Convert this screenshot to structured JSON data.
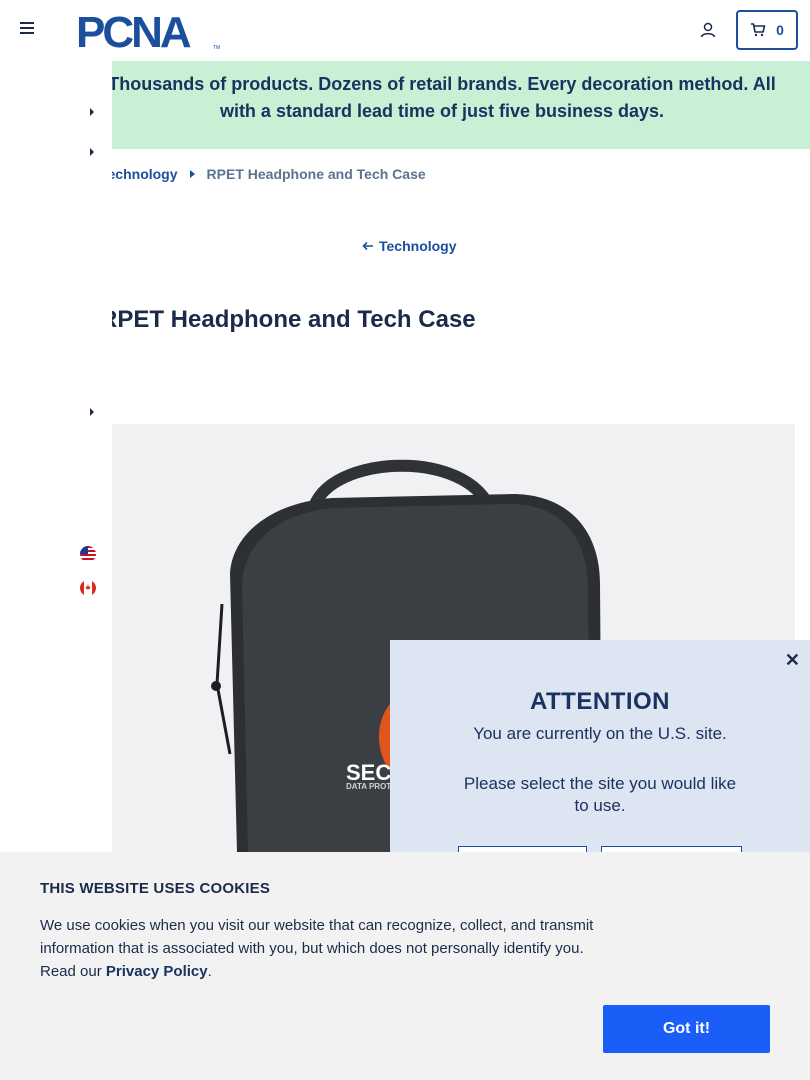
{
  "header": {
    "logo_text": "PCNA",
    "cart_count": "0"
  },
  "promo": {
    "text": "Thousands of products. Dozens of retail brands. Every decoration method. All with a standard lead time of just five business days."
  },
  "breadcrumb": {
    "parent": "Technology",
    "current": "RPET Headphone and Tech Case"
  },
  "back_link": "Technology",
  "product": {
    "title": "RPET Headphone and Tech Case",
    "logo_text": "SEC",
    "logo_subtext": "DATA PROT"
  },
  "attention": {
    "title": "ATTENTION",
    "message1": "You are currently on the U.S. site.",
    "message2": "Please select the site you would like to use."
  },
  "cookie": {
    "title": "THIS WEBSITE USES COOKIES",
    "text_before": "We use cookies when you visit our website that can recognize, collect, and transmit information that is associated with you, but which does not personally identify you. Read our ",
    "link": "Privacy Policy",
    "text_after": ".",
    "button": "Got it!"
  },
  "colors": {
    "brand_blue": "#1b4e9b",
    "promo_bg": "#c8f0d4",
    "cookie_button": "#1b5ef7"
  }
}
